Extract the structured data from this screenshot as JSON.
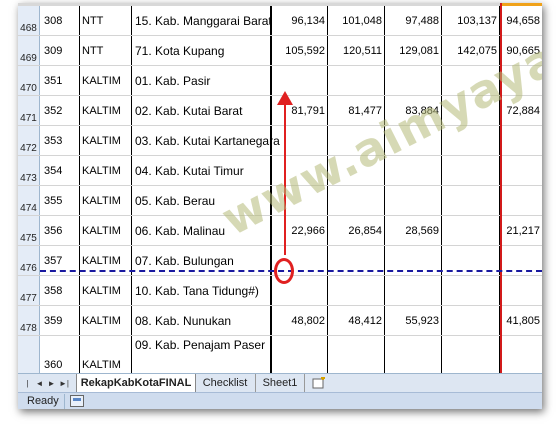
{
  "rows": [
    {
      "rownum": "468",
      "code": "308",
      "prov": "NTT",
      "name": "15. Kab. Manggarai Barat",
      "v1": "96,134",
      "v2": "101,048",
      "v3": "97,488",
      "v4": "103,137",
      "v5": "94,658"
    },
    {
      "rownum": "469",
      "code": "309",
      "prov": "NTT",
      "name": "71. Kota Kupang",
      "v1": "105,592",
      "v2": "120,511",
      "v3": "129,081",
      "v4": "142,075",
      "v5": "90,665"
    },
    {
      "rownum": "470",
      "code": "351",
      "prov": "KALTIM",
      "name": "01. Kab. Pasir",
      "v1": "",
      "v2": "",
      "v3": "",
      "v4": "",
      "v5": ""
    },
    {
      "rownum": "471",
      "code": "352",
      "prov": "KALTIM",
      "name": "02. Kab. Kutai Barat",
      "v1": "81,791",
      "v2": "81,477",
      "v3": "83,884",
      "v4": "",
      "v5": "72,884"
    },
    {
      "rownum": "472",
      "code": "353",
      "prov": "KALTIM",
      "name": "03. Kab. Kutai Kartanegara",
      "v1": "",
      "v2": "",
      "v3": "",
      "v4": "",
      "v5": ""
    },
    {
      "rownum": "473",
      "code": "354",
      "prov": "KALTIM",
      "name": "04. Kab. Kutai Timur",
      "v1": "",
      "v2": "",
      "v3": "",
      "v4": "",
      "v5": ""
    },
    {
      "rownum": "474",
      "code": "355",
      "prov": "KALTIM",
      "name": "05. Kab. Berau",
      "v1": "",
      "v2": "",
      "v3": "",
      "v4": "",
      "v5": ""
    },
    {
      "rownum": "475",
      "code": "356",
      "prov": "KALTIM",
      "name": "06. Kab. Malinau",
      "v1": "22,966",
      "v2": "26,854",
      "v3": "28,569",
      "v4": "",
      "v5": "21,217"
    },
    {
      "rownum": "476",
      "code": "357",
      "prov": "KALTIM",
      "name": "07. Kab. Bulungan",
      "v1": "",
      "v2": "",
      "v3": "",
      "v4": "",
      "v5": ""
    },
    {
      "rownum": "477",
      "code": "358",
      "prov": "KALTIM",
      "name": "10. Kab. Tana Tidung#)",
      "v1": "",
      "v2": "",
      "v3": "",
      "v4": "",
      "v5": ""
    },
    {
      "rownum": "478",
      "code": "359",
      "prov": "KALTIM",
      "name": "08. Kab. Nunukan",
      "v1": "48,802",
      "v2": "48,412",
      "v3": "55,923",
      "v4": "",
      "v5": "41,805"
    },
    {
      "rownum": "",
      "code": "360",
      "prov": "KALTIM",
      "name": "09. Kab. Penajam Paser",
      "v1": "",
      "v2": "",
      "v3": "",
      "v4": "",
      "v5": ""
    }
  ],
  "sheet_tabs": [
    {
      "label": "RekapKabKotaFINAL",
      "active": true
    },
    {
      "label": "Checklist",
      "active": false
    },
    {
      "label": "Sheet1",
      "active": false
    }
  ],
  "status": {
    "text": "Ready"
  },
  "watermark": "www.aimyaya.com",
  "colors": {
    "annotation": "#e02020",
    "page_break": "#1a1aa0",
    "row_header": "#e4ecf7",
    "accent": "#f0a21a"
  }
}
